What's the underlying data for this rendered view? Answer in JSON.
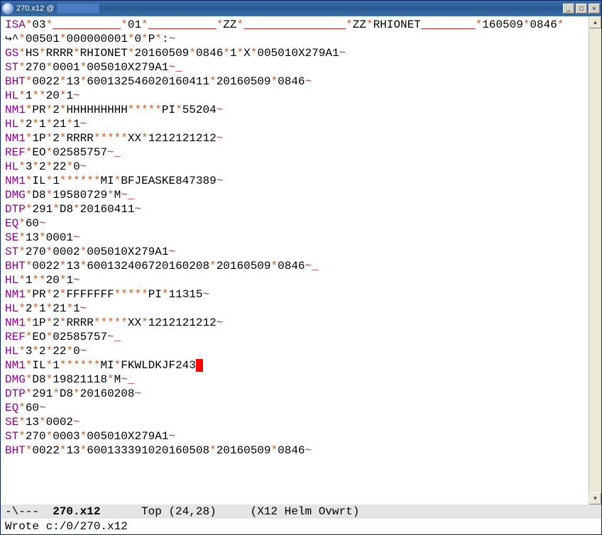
{
  "window": {
    "title_prefix": "270.x12 @",
    "min_glyph": "_",
    "max_glyph": "□",
    "close_glyph": "×"
  },
  "lines": [
    [
      [
        "seg",
        "ISA"
      ],
      [
        "star",
        "*"
      ],
      [
        "val",
        "03"
      ],
      [
        "star",
        "*"
      ],
      [
        "udl",
        "          "
      ],
      [
        "star",
        "*"
      ],
      [
        "val",
        "01"
      ],
      [
        "star",
        "*"
      ],
      [
        "udl",
        "          "
      ],
      [
        "star",
        "*"
      ],
      [
        "val",
        "ZZ"
      ],
      [
        "star",
        "*"
      ],
      [
        "udl",
        "               "
      ],
      [
        "star",
        "*"
      ],
      [
        "val",
        "ZZ"
      ],
      [
        "star",
        "*"
      ],
      [
        "val",
        "RHIONET"
      ],
      [
        "udl",
        "        "
      ],
      [
        "star",
        "*"
      ],
      [
        "val",
        "160509"
      ],
      [
        "star",
        "*"
      ],
      [
        "val",
        "0846"
      ],
      [
        "star",
        "*"
      ]
    ],
    [
      [
        "wrapg",
        "↪"
      ],
      [
        "val",
        "^"
      ],
      [
        "star",
        "*"
      ],
      [
        "val",
        "00501"
      ],
      [
        "star",
        "*"
      ],
      [
        "val",
        "000000001"
      ],
      [
        "star",
        "*"
      ],
      [
        "val",
        "0"
      ],
      [
        "star",
        "*"
      ],
      [
        "val",
        "P"
      ],
      [
        "star",
        "*"
      ],
      [
        "val",
        ":"
      ],
      [
        "til",
        "~"
      ]
    ],
    [
      [
        "seg",
        "GS"
      ],
      [
        "star",
        "*"
      ],
      [
        "val",
        "HS"
      ],
      [
        "star",
        "*"
      ],
      [
        "val",
        "RRRR"
      ],
      [
        "star",
        "*"
      ],
      [
        "val",
        "RHIONET"
      ],
      [
        "star",
        "*"
      ],
      [
        "val",
        "20160509"
      ],
      [
        "star",
        "*"
      ],
      [
        "val",
        "0846"
      ],
      [
        "star",
        "*"
      ],
      [
        "val",
        "1"
      ],
      [
        "star",
        "*"
      ],
      [
        "val",
        "X"
      ],
      [
        "star",
        "*"
      ],
      [
        "val",
        "005010X279A1"
      ],
      [
        "til",
        "~"
      ]
    ],
    [
      [
        "seg",
        "ST"
      ],
      [
        "star",
        "*"
      ],
      [
        "val",
        "270"
      ],
      [
        "star",
        "*"
      ],
      [
        "val",
        "0001"
      ],
      [
        "star",
        "*"
      ],
      [
        "val",
        "005010X279A1"
      ],
      [
        "til",
        "~"
      ],
      [
        "pad",
        "_"
      ]
    ],
    [
      [
        "seg",
        "BHT"
      ],
      [
        "star",
        "*"
      ],
      [
        "val",
        "0022"
      ],
      [
        "star",
        "*"
      ],
      [
        "val",
        "13"
      ],
      [
        "star",
        "*"
      ],
      [
        "val",
        "600132546020160411"
      ],
      [
        "star",
        "*"
      ],
      [
        "val",
        "20160509"
      ],
      [
        "star",
        "*"
      ],
      [
        "val",
        "0846"
      ],
      [
        "til",
        "~"
      ]
    ],
    [
      [
        "seg",
        "HL"
      ],
      [
        "star",
        "*"
      ],
      [
        "val",
        "1"
      ],
      [
        "star",
        "**"
      ],
      [
        "val",
        "20"
      ],
      [
        "star",
        "*"
      ],
      [
        "val",
        "1"
      ],
      [
        "til",
        "~"
      ]
    ],
    [
      [
        "seg",
        "NM1"
      ],
      [
        "star",
        "*"
      ],
      [
        "val",
        "PR"
      ],
      [
        "star",
        "*"
      ],
      [
        "val",
        "2"
      ],
      [
        "star",
        "*"
      ],
      [
        "val",
        "HHHHHHHHH"
      ],
      [
        "star",
        "*****"
      ],
      [
        "val",
        "PI"
      ],
      [
        "star",
        "*"
      ],
      [
        "val",
        "55204"
      ],
      [
        "til",
        "~"
      ]
    ],
    [
      [
        "seg",
        "HL"
      ],
      [
        "star",
        "*"
      ],
      [
        "val",
        "2"
      ],
      [
        "star",
        "*"
      ],
      [
        "val",
        "1"
      ],
      [
        "star",
        "*"
      ],
      [
        "val",
        "21"
      ],
      [
        "star",
        "*"
      ],
      [
        "val",
        "1"
      ],
      [
        "til",
        "~"
      ]
    ],
    [
      [
        "seg",
        "NM1"
      ],
      [
        "star",
        "*"
      ],
      [
        "val",
        "1P"
      ],
      [
        "star",
        "*"
      ],
      [
        "val",
        "2"
      ],
      [
        "star",
        "*"
      ],
      [
        "val",
        "RRRR"
      ],
      [
        "star",
        "*****"
      ],
      [
        "val",
        "XX"
      ],
      [
        "star",
        "*"
      ],
      [
        "val",
        "1212121212"
      ],
      [
        "til",
        "~"
      ]
    ],
    [
      [
        "seg",
        "REF"
      ],
      [
        "star",
        "*"
      ],
      [
        "val",
        "EO"
      ],
      [
        "star",
        "*"
      ],
      [
        "val",
        "02585757"
      ],
      [
        "til",
        "~"
      ],
      [
        "pad",
        "_"
      ]
    ],
    [
      [
        "seg",
        "HL"
      ],
      [
        "star",
        "*"
      ],
      [
        "val",
        "3"
      ],
      [
        "star",
        "*"
      ],
      [
        "val",
        "2"
      ],
      [
        "star",
        "*"
      ],
      [
        "val",
        "22"
      ],
      [
        "star",
        "*"
      ],
      [
        "val",
        "0"
      ],
      [
        "til",
        "~"
      ]
    ],
    [
      [
        "seg",
        "NM1"
      ],
      [
        "star",
        "*"
      ],
      [
        "val",
        "IL"
      ],
      [
        "star",
        "*"
      ],
      [
        "val",
        "1"
      ],
      [
        "star",
        "******"
      ],
      [
        "val",
        "MI"
      ],
      [
        "star",
        "*"
      ],
      [
        "val",
        "BFJEASKE847389"
      ],
      [
        "til",
        "~"
      ]
    ],
    [
      [
        "seg",
        "DMG"
      ],
      [
        "star",
        "*"
      ],
      [
        "val",
        "D8"
      ],
      [
        "star",
        "*"
      ],
      [
        "val",
        "19580729"
      ],
      [
        "star",
        "*"
      ],
      [
        "val",
        "M"
      ],
      [
        "til",
        "~"
      ],
      [
        "pad",
        "_"
      ]
    ],
    [
      [
        "seg",
        "DTP"
      ],
      [
        "star",
        "*"
      ],
      [
        "val",
        "291"
      ],
      [
        "star",
        "*"
      ],
      [
        "val",
        "D8"
      ],
      [
        "star",
        "*"
      ],
      [
        "val",
        "20160411"
      ],
      [
        "til",
        "~"
      ]
    ],
    [
      [
        "seg",
        "EQ"
      ],
      [
        "star",
        "*"
      ],
      [
        "val",
        "60"
      ],
      [
        "til",
        "~"
      ]
    ],
    [
      [
        "seg",
        "SE"
      ],
      [
        "star",
        "*"
      ],
      [
        "val",
        "13"
      ],
      [
        "star",
        "*"
      ],
      [
        "val",
        "0001"
      ],
      [
        "til",
        "~"
      ]
    ],
    [
      [
        "seg",
        "ST"
      ],
      [
        "star",
        "*"
      ],
      [
        "val",
        "270"
      ],
      [
        "star",
        "*"
      ],
      [
        "val",
        "0002"
      ],
      [
        "star",
        "*"
      ],
      [
        "val",
        "005010X279A1"
      ],
      [
        "til",
        "~"
      ]
    ],
    [
      [
        "seg",
        "BHT"
      ],
      [
        "star",
        "*"
      ],
      [
        "val",
        "0022"
      ],
      [
        "star",
        "*"
      ],
      [
        "val",
        "13"
      ],
      [
        "star",
        "*"
      ],
      [
        "val",
        "600132406720160208"
      ],
      [
        "star",
        "*"
      ],
      [
        "val",
        "20160509"
      ],
      [
        "star",
        "*"
      ],
      [
        "val",
        "0846"
      ],
      [
        "til",
        "~"
      ],
      [
        "pad",
        "_"
      ]
    ],
    [
      [
        "seg",
        "HL"
      ],
      [
        "star",
        "*"
      ],
      [
        "val",
        "1"
      ],
      [
        "star",
        "**"
      ],
      [
        "val",
        "20"
      ],
      [
        "star",
        "*"
      ],
      [
        "val",
        "1"
      ],
      [
        "til",
        "~"
      ]
    ],
    [
      [
        "seg",
        "NM1"
      ],
      [
        "star",
        "*"
      ],
      [
        "val",
        "PR"
      ],
      [
        "star",
        "*"
      ],
      [
        "val",
        "2"
      ],
      [
        "star",
        "*"
      ],
      [
        "val",
        "FFFFFFF"
      ],
      [
        "star",
        "*****"
      ],
      [
        "val",
        "PI"
      ],
      [
        "star",
        "*"
      ],
      [
        "val",
        "11315"
      ],
      [
        "til",
        "~"
      ]
    ],
    [
      [
        "seg",
        "HL"
      ],
      [
        "star",
        "*"
      ],
      [
        "val",
        "2"
      ],
      [
        "star",
        "*"
      ],
      [
        "val",
        "1"
      ],
      [
        "star",
        "*"
      ],
      [
        "val",
        "21"
      ],
      [
        "star",
        "*"
      ],
      [
        "val",
        "1"
      ],
      [
        "til",
        "~"
      ]
    ],
    [
      [
        "seg",
        "NM1"
      ],
      [
        "star",
        "*"
      ],
      [
        "val",
        "1P"
      ],
      [
        "star",
        "*"
      ],
      [
        "val",
        "2"
      ],
      [
        "star",
        "*"
      ],
      [
        "val",
        "RRRR"
      ],
      [
        "star",
        "*****"
      ],
      [
        "val",
        "XX"
      ],
      [
        "star",
        "*"
      ],
      [
        "val",
        "1212121212"
      ],
      [
        "til",
        "~"
      ]
    ],
    [
      [
        "seg",
        "REF"
      ],
      [
        "star",
        "*"
      ],
      [
        "val",
        "EO"
      ],
      [
        "star",
        "*"
      ],
      [
        "val",
        "02585757"
      ],
      [
        "til",
        "~"
      ],
      [
        "pad",
        "_"
      ]
    ],
    [
      [
        "seg",
        "HL"
      ],
      [
        "star",
        "*"
      ],
      [
        "val",
        "3"
      ],
      [
        "star",
        "*"
      ],
      [
        "val",
        "2"
      ],
      [
        "star",
        "*"
      ],
      [
        "val",
        "22"
      ],
      [
        "star",
        "*"
      ],
      [
        "val",
        "0"
      ],
      [
        "til",
        "~"
      ]
    ],
    [
      [
        "seg",
        "NM1"
      ],
      [
        "star",
        "*"
      ],
      [
        "val",
        "IL"
      ],
      [
        "star",
        "*"
      ],
      [
        "val",
        "1"
      ],
      [
        "star",
        "******"
      ],
      [
        "val",
        "MI"
      ],
      [
        "star",
        "*"
      ],
      [
        "val",
        "FKWLDKJF243"
      ],
      [
        "cur",
        "~"
      ]
    ],
    [
      [
        "seg",
        "DMG"
      ],
      [
        "star",
        "*"
      ],
      [
        "val",
        "D8"
      ],
      [
        "star",
        "*"
      ],
      [
        "val",
        "19821118"
      ],
      [
        "star",
        "*"
      ],
      [
        "val",
        "M"
      ],
      [
        "til",
        "~"
      ],
      [
        "pad",
        "_"
      ]
    ],
    [
      [
        "seg",
        "DTP"
      ],
      [
        "star",
        "*"
      ],
      [
        "val",
        "291"
      ],
      [
        "star",
        "*"
      ],
      [
        "val",
        "D8"
      ],
      [
        "star",
        "*"
      ],
      [
        "val",
        "20160208"
      ],
      [
        "til",
        "~"
      ]
    ],
    [
      [
        "seg",
        "EQ"
      ],
      [
        "star",
        "*"
      ],
      [
        "val",
        "60"
      ],
      [
        "til",
        "~"
      ]
    ],
    [
      [
        "seg",
        "SE"
      ],
      [
        "star",
        "*"
      ],
      [
        "val",
        "13"
      ],
      [
        "star",
        "*"
      ],
      [
        "val",
        "0002"
      ],
      [
        "til",
        "~"
      ]
    ],
    [
      [
        "seg",
        "ST"
      ],
      [
        "star",
        "*"
      ],
      [
        "val",
        "270"
      ],
      [
        "star",
        "*"
      ],
      [
        "val",
        "0003"
      ],
      [
        "star",
        "*"
      ],
      [
        "val",
        "005010X279A1"
      ],
      [
        "til",
        "~"
      ]
    ],
    [
      [
        "seg",
        "BHT"
      ],
      [
        "star",
        "*"
      ],
      [
        "val",
        "0022"
      ],
      [
        "star",
        "*"
      ],
      [
        "val",
        "13"
      ],
      [
        "star",
        "*"
      ],
      [
        "val",
        "600133391020160508"
      ],
      [
        "star",
        "*"
      ],
      [
        "val",
        "20160509"
      ],
      [
        "star",
        "*"
      ],
      [
        "val",
        "0846"
      ],
      [
        "til",
        "~"
      ]
    ]
  ],
  "modeline": {
    "left": "-\\---  ",
    "buffer": "270.x12",
    "center": "      Top (24,28)     (X12 Helm Ovwrt)"
  },
  "minibuffer": "Wrote c:/0/270.x12"
}
